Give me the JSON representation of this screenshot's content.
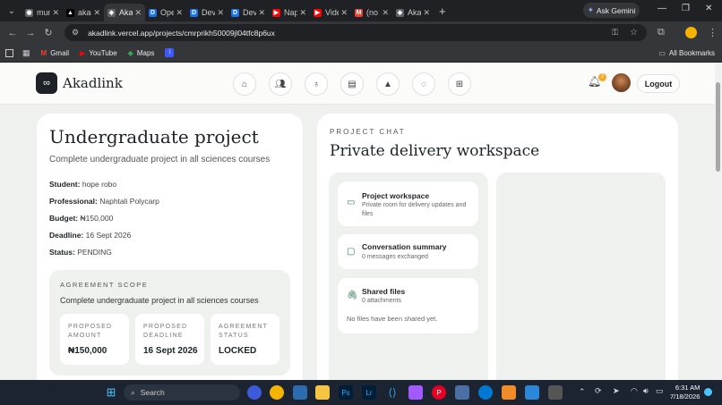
{
  "browser": {
    "tabs": [
      {
        "label": "muni",
        "color": "#5f6368",
        "glyph": "◉"
      },
      {
        "label": "akad",
        "color": "#000000",
        "glyph": "▲"
      },
      {
        "label": "Akad",
        "color": "#5f6368",
        "glyph": "◈",
        "active": true
      },
      {
        "label": "Ope",
        "color": "#1a73e8",
        "glyph": "D"
      },
      {
        "label": "Dev",
        "color": "#1a73e8",
        "glyph": "D"
      },
      {
        "label": "Dev",
        "color": "#1a73e8",
        "glyph": "D"
      },
      {
        "label": "Napt",
        "color": "#ff0000",
        "glyph": "▶"
      },
      {
        "label": "Vide",
        "color": "#ff0000",
        "glyph": "▶"
      },
      {
        "label": "(no s",
        "color": "#ea4335",
        "glyph": "M"
      },
      {
        "label": "Akad",
        "color": "#5f6368",
        "glyph": "◈"
      }
    ],
    "gemini_label": "Ask Gemini",
    "url": "akadlink.vercel.app/projects/cmrprikh50009jl04tfc8p6ux",
    "bookmarks": [
      {
        "label": "Gmail",
        "icon": "gmail-icon"
      },
      {
        "label": "YouTube",
        "icon": "youtube-icon"
      },
      {
        "label": "Maps",
        "icon": "maps-icon"
      }
    ],
    "all_bookmarks": "All Bookmarks"
  },
  "header": {
    "brand": "Akadlink",
    "logout": "Logout",
    "notification_count": "2",
    "nav_icons": [
      "home-icon",
      "users-icon",
      "award-icon",
      "document-icon",
      "graduation-cap-icon",
      "chat-icon",
      "grid-icon"
    ]
  },
  "project": {
    "title": "Undergraduate project",
    "subtitle": "Complete undergraduate project in all sciences courses",
    "student_label": "Student:",
    "student": "hope robo",
    "professional_label": "Professional:",
    "professional": "Naphtali Polycarp",
    "budget_label": "Budget:",
    "budget": "₦150,000",
    "deadline_label": "Deadline:",
    "deadline": "16 Sept 2026",
    "status_label": "Status:",
    "status": "PENDING"
  },
  "scope": {
    "heading": "AGREEMENT SCOPE",
    "text": "Complete undergraduate project in all sciences courses",
    "proposed_amount_label": "PROPOSED AMOUNT",
    "proposed_amount": "₦150,000",
    "proposed_deadline_label": "PROPOSED DEADLINE",
    "proposed_deadline": "16 Sept 2026",
    "agreement_status_label": "AGREEMENT STATUS",
    "agreement_status": "LOCKED"
  },
  "chat": {
    "heading": "PROJECT CHAT",
    "title": "Private delivery workspace",
    "workspace_title": "Project workspace",
    "workspace_sub": "Private room for delivery updates and files",
    "summary_title": "Conversation summary",
    "summary_sub": "0 messages exchanged",
    "files_title": "Shared files",
    "files_sub": "0 attachments",
    "files_empty": "No files have been shared yet."
  },
  "taskbar": {
    "search": "Search",
    "time": "6:31 AM",
    "date": "7/18/2026"
  }
}
